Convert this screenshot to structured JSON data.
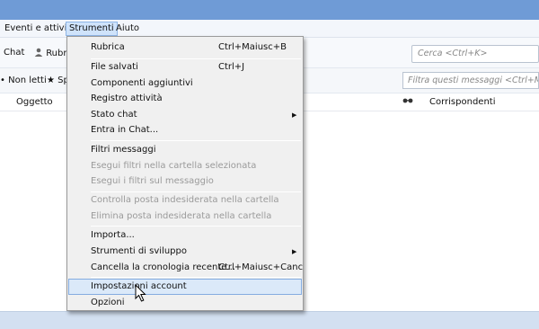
{
  "menubar": {
    "items": [
      "Eventi e attività",
      "Strumenti",
      "Aiuto"
    ]
  },
  "toolbar": {
    "chat_label": "Chat",
    "rubrica_label": "Rubric",
    "search_placeholder": "Cerca <Ctrl+K>"
  },
  "filterbar": {
    "unread_label": "Non letti",
    "starred_label": "Sp",
    "filter_placeholder": "Filtra questi messaggi <Ctrl+Maiusc"
  },
  "columns": {
    "subject": "Oggetto",
    "correspondents": "Corrispondenti"
  },
  "dropdown": {
    "items": [
      {
        "label": "Rubrica",
        "shortcut": "Ctrl+Maiusc+B",
        "disabled": false,
        "submenu": false
      },
      {
        "label": "File salvati",
        "shortcut": "Ctrl+J",
        "disabled": false,
        "submenu": false
      },
      {
        "label": "Componenti aggiuntivi",
        "shortcut": "",
        "disabled": false,
        "submenu": false
      },
      {
        "label": "Registro attività",
        "shortcut": "",
        "disabled": false,
        "submenu": false
      },
      {
        "label": "Stato chat",
        "shortcut": "",
        "disabled": false,
        "submenu": true
      },
      {
        "label": "Entra in Chat...",
        "shortcut": "",
        "disabled": false,
        "submenu": false
      },
      {
        "label": "Filtri messaggi",
        "shortcut": "",
        "disabled": false,
        "submenu": false
      },
      {
        "label": "Esegui filtri nella cartella selezionata",
        "shortcut": "",
        "disabled": true,
        "submenu": false
      },
      {
        "label": "Esegui i filtri sul messaggio",
        "shortcut": "",
        "disabled": true,
        "submenu": false
      },
      {
        "label": "Controlla posta indesiderata nella cartella",
        "shortcut": "",
        "disabled": true,
        "submenu": false
      },
      {
        "label": "Elimina posta indesiderata nella cartella",
        "shortcut": "",
        "disabled": true,
        "submenu": false
      },
      {
        "label": "Importa...",
        "shortcut": "",
        "disabled": false,
        "submenu": false
      },
      {
        "label": "Strumenti di sviluppo",
        "shortcut": "",
        "disabled": false,
        "submenu": true
      },
      {
        "label": "Cancella la cronologia recente...",
        "shortcut": "Ctrl+Maiusc+Canc",
        "disabled": false,
        "submenu": false
      },
      {
        "label": "Impostazioni account",
        "shortcut": "",
        "disabled": false,
        "submenu": false,
        "highlighted": true
      },
      {
        "label": "Opzioni",
        "shortcut": "",
        "disabled": false,
        "submenu": false
      }
    ]
  }
}
